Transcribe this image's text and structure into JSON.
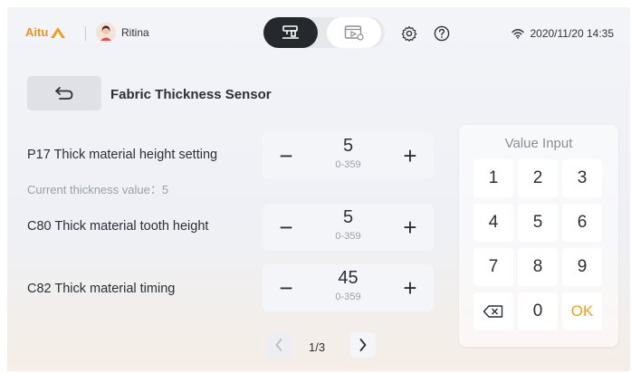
{
  "topbar": {
    "brand": "Aitu",
    "user_name": "Ritina",
    "datetime": "2020/11/20 14:35"
  },
  "page": {
    "title": "Fabric Thickness Sensor"
  },
  "params": [
    {
      "label": "P17 Thick material height setting",
      "value": "5",
      "range": "0-359",
      "sub": "Current thickness value：5"
    },
    {
      "label": "C80 Thick material tooth height",
      "value": "5",
      "range": "0-359"
    },
    {
      "label": "C82 Thick material timing",
      "value": "45",
      "range": "0-359"
    }
  ],
  "stepper": {
    "minus": "−",
    "plus": "+"
  },
  "pagination": {
    "text": "1/3"
  },
  "keypad": {
    "title": "Value Input",
    "keys": [
      "1",
      "2",
      "3",
      "4",
      "5",
      "6",
      "7",
      "8",
      "9",
      "⌫",
      "0",
      "OK"
    ]
  },
  "colors": {
    "accent": "#f0a020",
    "brand": "#e8921f",
    "dark": "#25282d"
  }
}
